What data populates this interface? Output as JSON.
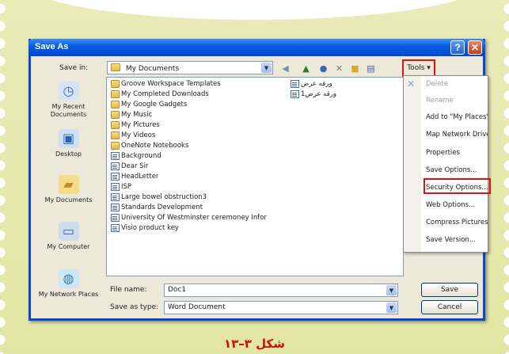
{
  "dialog": {
    "title": "Save As",
    "help_glyph": "?",
    "close_glyph": "✕"
  },
  "toolbar": {
    "save_in_label": "Save in:",
    "save_in_value": "My Documents",
    "tools_label": "Tools ▾"
  },
  "places": [
    {
      "label": "My Recent Documents",
      "icon": "recent-documents-icon"
    },
    {
      "label": "Desktop",
      "icon": "desktop-icon"
    },
    {
      "label": "My Documents",
      "icon": "my-documents-icon"
    },
    {
      "label": "My Computer",
      "icon": "my-computer-icon"
    },
    {
      "label": "My Network Places",
      "icon": "network-places-icon"
    }
  ],
  "files": [
    {
      "name": "Groove Workspace Templates",
      "type": "folder"
    },
    {
      "name": "My Completed Downloads",
      "type": "folder"
    },
    {
      "name": "My Google Gadgets",
      "type": "folder"
    },
    {
      "name": "My Music",
      "type": "folder"
    },
    {
      "name": "My Pictures",
      "type": "folder"
    },
    {
      "name": "My Videos",
      "type": "folder"
    },
    {
      "name": "OneNote Notebooks",
      "type": "folder"
    },
    {
      "name": "Background",
      "type": "doc"
    },
    {
      "name": "Dear Sir",
      "type": "doc"
    },
    {
      "name": "HeadLetter",
      "type": "doc"
    },
    {
      "name": "ISP",
      "type": "doc"
    },
    {
      "name": "Large bowel obstruction3",
      "type": "doc"
    },
    {
      "name": "Standards Development",
      "type": "doc"
    },
    {
      "name": "University Of Westminster ceremoney Infor",
      "type": "doc"
    },
    {
      "name": "Visio product key",
      "type": "doc"
    }
  ],
  "files_col2": [
    {
      "name": "ورقه عرض",
      "type": "doc"
    },
    {
      "name": "ورقه عرض1",
      "type": "doc"
    }
  ],
  "tools_menu": [
    {
      "label": "Delete",
      "disabled": true
    },
    {
      "label": "Rename",
      "disabled": true
    },
    {
      "label": "Add to \"My Places\"",
      "disabled": false
    },
    {
      "label": "Map Network Drive...",
      "disabled": false
    },
    {
      "label": "Properties",
      "disabled": false
    },
    {
      "label": "Save Options...",
      "disabled": false
    },
    {
      "label": "Security Options...",
      "disabled": false
    },
    {
      "label": "Web Options...",
      "disabled": false
    },
    {
      "label": "Compress Pictures...",
      "disabled": false
    },
    {
      "label": "Save Version...",
      "disabled": false
    }
  ],
  "footer": {
    "file_name_label": "File name:",
    "file_name_value": "Doc1",
    "save_type_label": "Save as type:",
    "save_type_value": "Word Document",
    "save_button": "Save",
    "cancel_button": "Cancel"
  },
  "caption": "شکل ۳–۱۳",
  "colors": {
    "titlebar": "#0a5fe0",
    "highlight": "#e01010",
    "caption": "#cc1010"
  }
}
